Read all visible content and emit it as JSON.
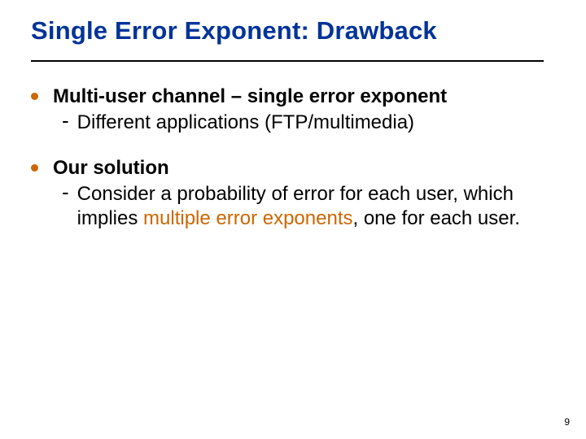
{
  "title": "Single Error Exponent: Drawback",
  "bullets": [
    {
      "text": "Multi-user channel – single error exponent",
      "subs": [
        {
          "plain": "Different applications (FTP/multimedia)"
        }
      ]
    },
    {
      "text": "Our solution",
      "subs": [
        {
          "pre": "Consider a probability of error for each user, which implies ",
          "hl": "multiple error exponents",
          "post": ", one for each user."
        }
      ]
    }
  ],
  "page_number": "9"
}
